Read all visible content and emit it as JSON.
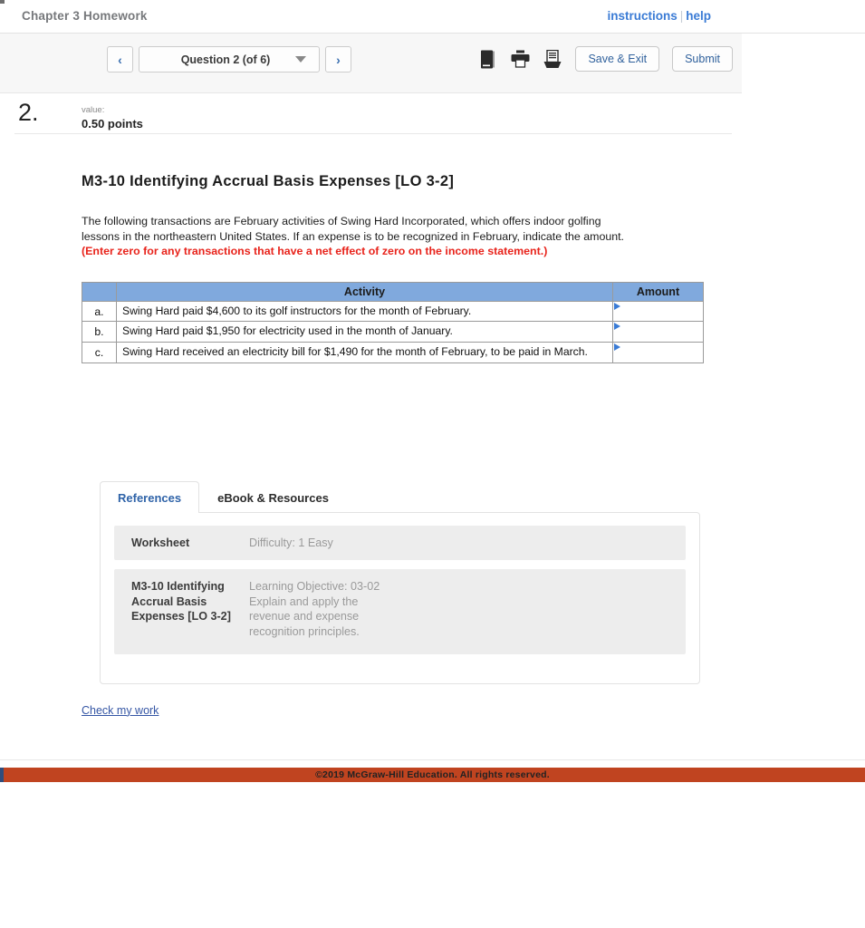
{
  "header": {
    "chapter_title": "Chapter 3 Homework",
    "links": {
      "instructions": "instructions",
      "separator": "|",
      "help": "help"
    }
  },
  "toolbar": {
    "prev_label": "‹",
    "next_label": "›",
    "question_select": "Question 2 (of 6)",
    "icons": [
      "ebook-icon",
      "print-icon",
      "print-tray-icon"
    ],
    "save_exit_label": "Save & Exit",
    "submit_label": "Submit"
  },
  "question": {
    "number": "2.",
    "value_label": "value:",
    "points": "0.50 points",
    "title": "M3-10 Identifying Accrual Basis Expenses [LO 3-2]",
    "description_plain": "The following transactions are February activities of Swing Hard Incorporated, which offers indoor golfing lessons in the northeastern United States. If an expense is to be recognized in February, indicate the amount. ",
    "description_warning": "(Enter zero for any transactions that have a net effect of zero on the income statement.)"
  },
  "table": {
    "headers": [
      "",
      "Activity",
      "Amount"
    ],
    "rows": [
      {
        "key": "a.",
        "activity": "Swing Hard paid $4,600 to its golf instructors for the month of February.",
        "amount": ""
      },
      {
        "key": "b.",
        "activity": "Swing Hard paid $1,950 for electricity used in the month of January.",
        "amount": ""
      },
      {
        "key": "c.",
        "activity": "Swing Hard received an electricity bill for $1,490 for the month of February, to be paid in March.",
        "amount": ""
      }
    ]
  },
  "tabs": [
    {
      "label": "References",
      "active": true
    },
    {
      "label": "eBook & Resources",
      "active": false
    }
  ],
  "references": [
    {
      "key": "Worksheet",
      "value": "Difficulty: 1 Easy"
    },
    {
      "key": "M3-10 Identifying Accrual Basis Expenses [LO 3-2]",
      "value": "Learning Objective: 03-02 Explain and apply the revenue and expense recognition principles."
    }
  ],
  "check_my_work": "Check my work",
  "footer": {
    "copyright": "©2019 McGraw-Hill Education. All rights reserved."
  },
  "colors": {
    "link_blue": "#3a7bd5",
    "table_header_blue": "#80a9dd",
    "warning_red": "#e8231b",
    "footer_orange": "#c04420",
    "tab_active_blue": "#2f63a8"
  }
}
